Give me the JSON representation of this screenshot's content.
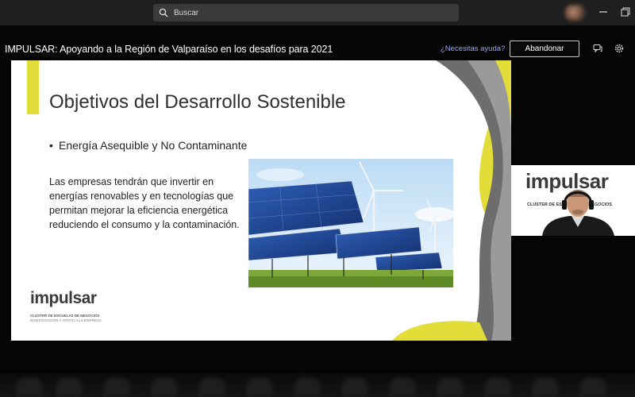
{
  "search": {
    "placeholder": "Buscar"
  },
  "meeting": {
    "title": "IMPULSAR: Apoyando a la Región de Valparaíso en los desafíos para 2021",
    "help_label": "¿Necesitas ayuda?",
    "leave_label": "Abandonar"
  },
  "slide": {
    "title": "Objetivos del Desarrollo Sostenible",
    "bullet_mark": "•",
    "bullet_text": "Energía Asequible y No Contaminante",
    "body": "Las empresas tendrán que invertir en energías renovables y en tecnologías que permitan mejorar la eficiencia energética reduciendo el consumo y la contaminación.",
    "logo_word": "impulsar",
    "logo_sub1": "CLUSTER DE ESCUELAS DE NEGOCIOS",
    "logo_sub2": "INVESTIGACIÓN Y APOYO A LA EMPRESA"
  },
  "video": {
    "brand": "impulsar",
    "brand_sub": "CLUSTER DE ESCUELAS DE NEGOCIOS"
  },
  "colors": {
    "accent_yellow": "#e3dd3a",
    "link_blue": "#9aa6f5",
    "panel_gray": "#3a3a3a"
  },
  "icons": [
    "search-icon",
    "minimize-icon",
    "maximize-icon",
    "chat-icon",
    "gear-icon"
  ]
}
